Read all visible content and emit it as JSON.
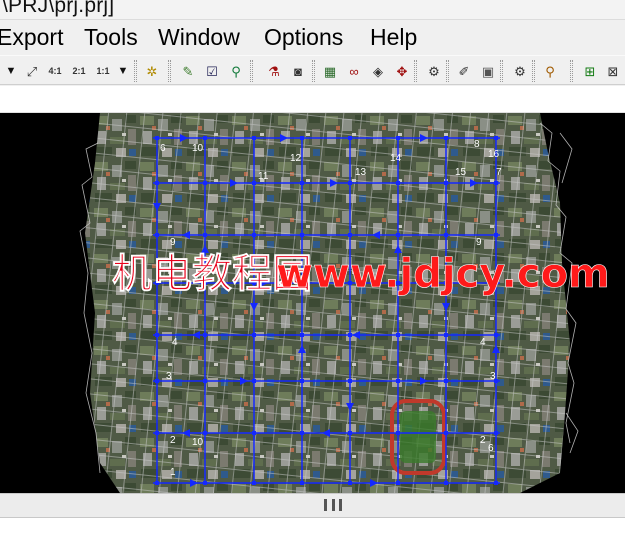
{
  "window": {
    "title": "\\PRJ\\prj.prj]"
  },
  "menu": [
    {
      "id": "export",
      "label": "Export"
    },
    {
      "id": "tools",
      "label": "Tools"
    },
    {
      "id": "window",
      "label": "Window"
    },
    {
      "id": "options",
      "label": "Options"
    },
    {
      "id": "help",
      "label": "Help"
    }
  ],
  "toolbar": {
    "zoom_labels": [
      "4:1",
      "2:1",
      "1:1"
    ]
  },
  "viewport": {
    "watermark_cn": "机电教程园",
    "watermark_url": "www.jdjcy.com",
    "strip_labels": [
      "6",
      "10",
      "12",
      "13",
      "14",
      "15",
      "16",
      "7",
      "8",
      "11",
      "9",
      "9",
      "4",
      "4",
      "3",
      "3",
      "2",
      "2",
      "1",
      "10",
      "6"
    ]
  },
  "colors": {
    "background": "#000000",
    "flight_lines": "#1428ff",
    "footprints": "#c8c8c8",
    "watermark_cn": "#e8001a",
    "watermark_url_red": "#ff1a1a",
    "watermark_url_blue": "#2a2aff"
  }
}
